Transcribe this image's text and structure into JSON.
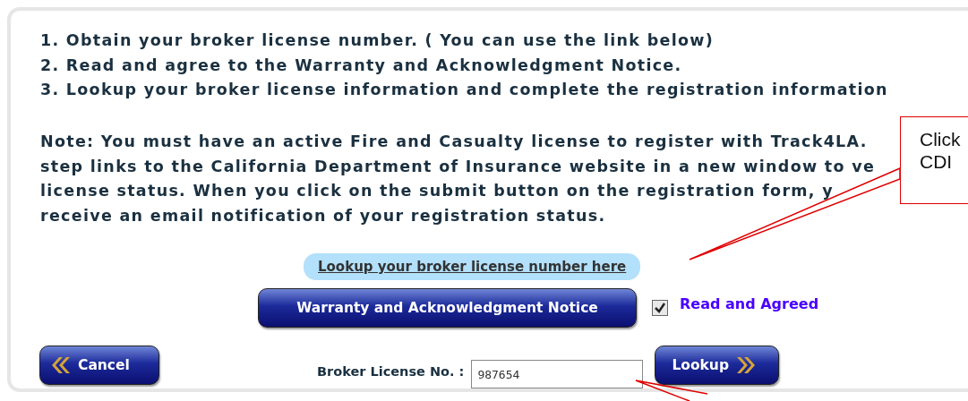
{
  "steps": [
    "1. Obtain your broker license number. ( You can use the link below)",
    "2. Read and agree to the Warranty and Acknowledgment Notice.",
    "3. Lookup your broker license information and complete the registration information"
  ],
  "note_lines": [
    "Note: You must have an active Fire and Casualty license to register with Track4LA.",
    "step links to the California Department of Insurance website in a new window to ve",
    "license status. When you click on the submit button on the registration form, y",
    "receive an email notification of your registration status."
  ],
  "lookup_link": "Lookup your broker license number here",
  "warranty_button": "Warranty and Acknowledgment Notice",
  "agreement": {
    "label": "Read and Agreed",
    "checked": true
  },
  "cancel_button": "Cancel",
  "license_field": {
    "label": "Broker License No. :",
    "value": "987654"
  },
  "lookup_button": "Lookup",
  "callout": {
    "lines": [
      "Click",
      "CDI"
    ]
  }
}
